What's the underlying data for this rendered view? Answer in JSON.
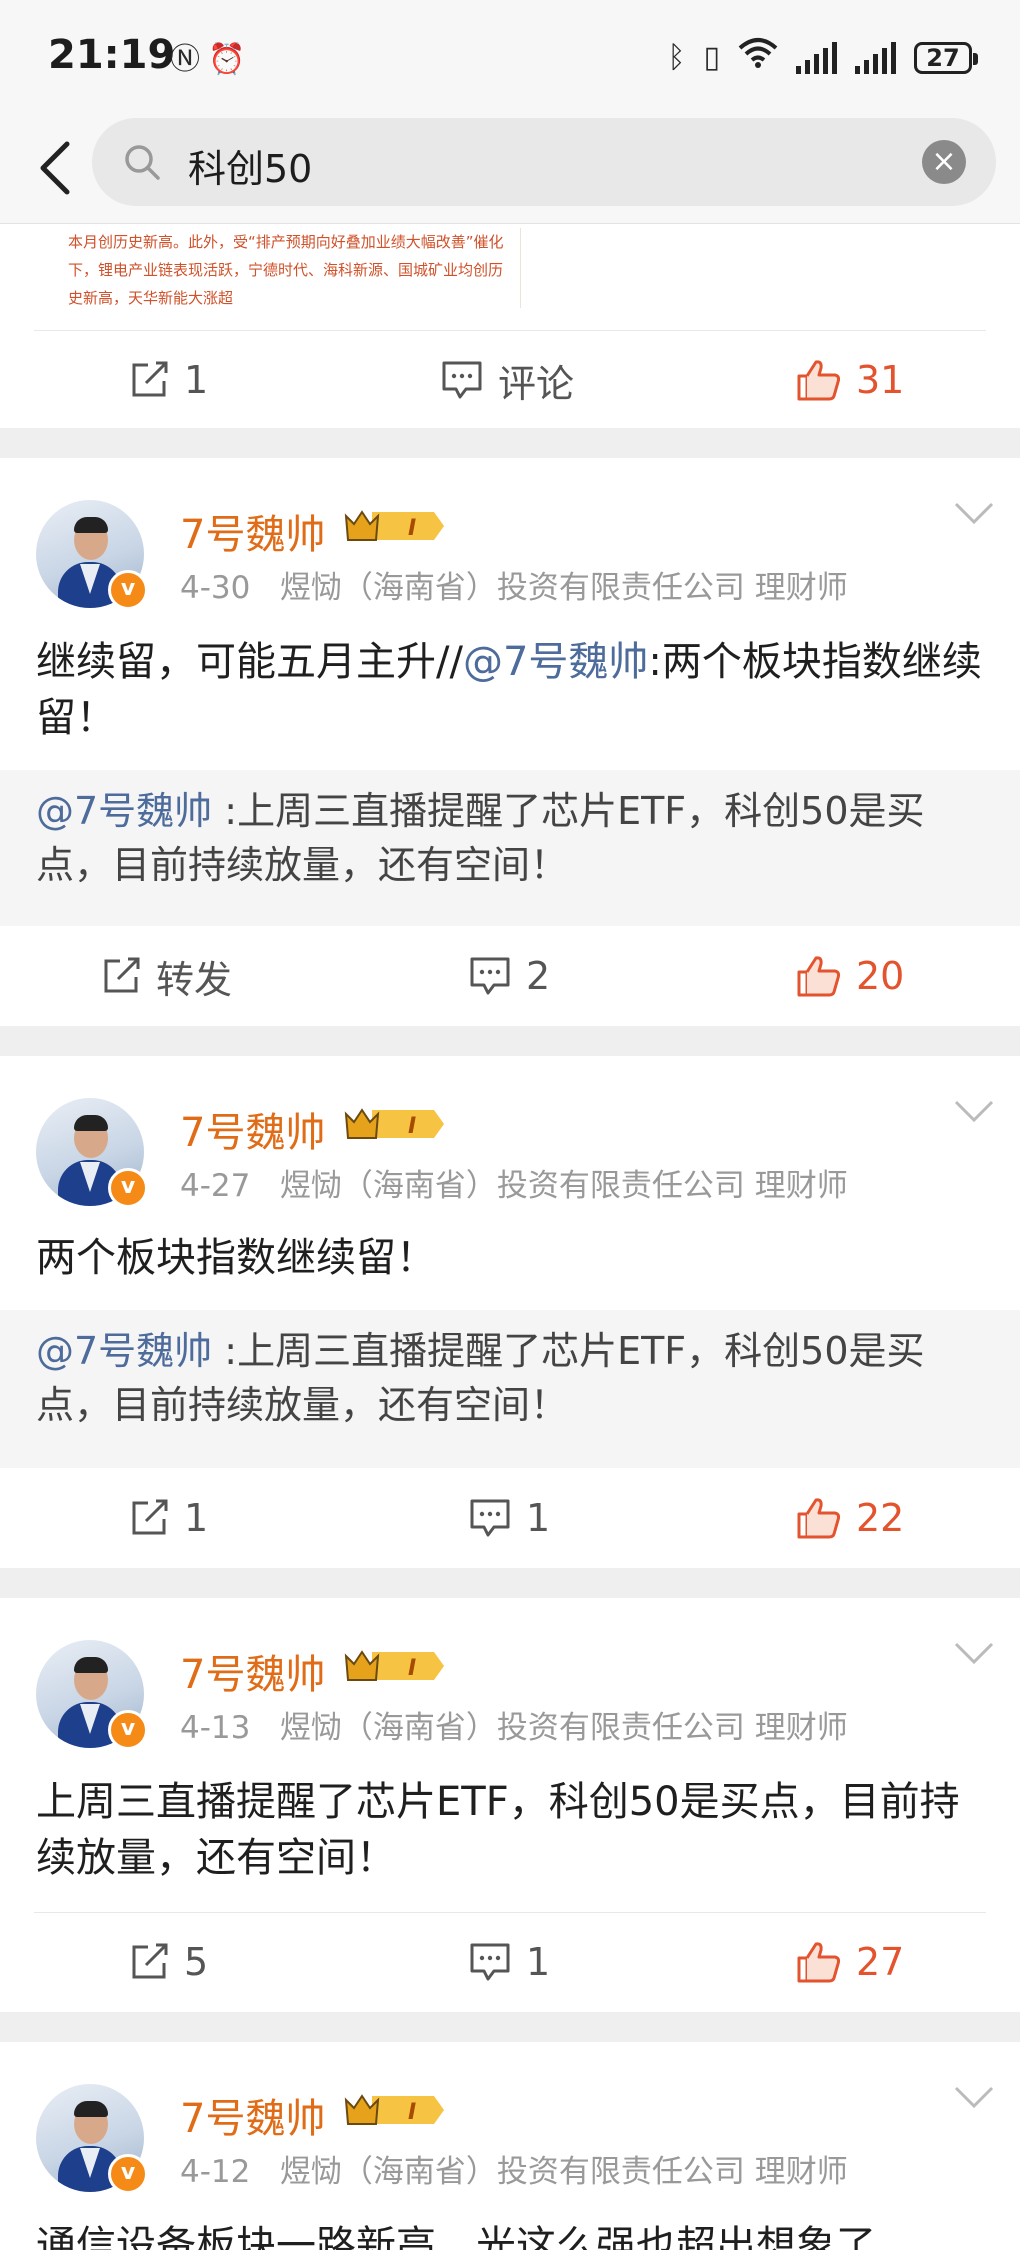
{
  "status_bar": {
    "time": "21:19",
    "battery": "27"
  },
  "search": {
    "query": "科创50"
  },
  "top_card": {
    "snippet": "本月创历史新高。此外，受“排产预期向好叠加业绩大幅改善”催化下，锂电产业链表现活跃，宁德时代、海科新源、国城矿业均创历史新高，天华新能大涨超",
    "repost": "1",
    "comment": "评论",
    "like": "31"
  },
  "posts": [
    {
      "user": "7号魏帅",
      "level": "I",
      "date": "4-30",
      "source": "煜恸（海南省）投资有限责任公司 理财师",
      "text_pre": "继续留，可能五月主升//",
      "text_mention": "@7号魏帅",
      "text_post": ":两个板块指数继续留！",
      "quote_mention": "@7号魏帅",
      "quote_text": " :上周三直播提醒了芯片ETF，科创50是买点，目前持续放量，还有空间！",
      "repost": "转发",
      "comment": "2",
      "like": "20"
    },
    {
      "user": "7号魏帅",
      "level": "I",
      "date": "4-27",
      "source": "煜恸（海南省）投资有限责任公司 理财师",
      "text": "两个板块指数继续留！",
      "quote_mention": "@7号魏帅",
      "quote_text": " :上周三直播提醒了芯片ETF，科创50是买点，目前持续放量，还有空间！",
      "repost": "1",
      "comment": "1",
      "like": "22"
    },
    {
      "user": "7号魏帅",
      "level": "I",
      "date": "4-13",
      "source": "煜恸（海南省）投资有限责任公司 理财师",
      "text": "上周三直播提醒了芯片ETF，科创50是买点，目前持续放量，还有空间！",
      "repost": "5",
      "comment": "1",
      "like": "27"
    },
    {
      "user": "7号魏帅",
      "level": "I",
      "date": "4-12",
      "source": "煜恸（海南省）投资有限责任公司 理财师",
      "text": "通信设备板块一路新高，光这么强也超出想象了"
    }
  ],
  "icons": {
    "back": "chevron-left-icon",
    "search": "search-icon",
    "clear": "clear-icon",
    "repost": "repost-icon",
    "comment": "comment-icon",
    "like": "thumbs-up-icon",
    "more": "chevron-down-icon"
  },
  "colors": {
    "accent": "#e06c17",
    "like": "#e2532e",
    "mention": "#4d6b9b"
  }
}
